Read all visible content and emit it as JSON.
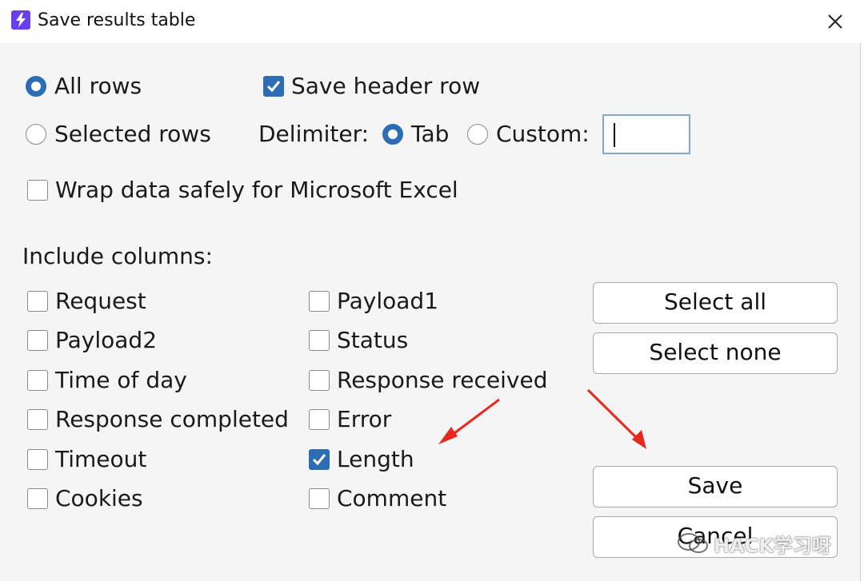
{
  "window": {
    "title": "Save results table"
  },
  "rows_option": {
    "all_rows": "All rows",
    "selected_rows": "Selected rows",
    "selected": "all_rows"
  },
  "save_header_row": {
    "label": "Save header row",
    "checked": true
  },
  "delimiter": {
    "label": "Delimiter:",
    "tab": "Tab",
    "custom": "Custom:",
    "selected": "tab",
    "custom_value": ""
  },
  "wrap_excel": {
    "label": "Wrap data safely for Microsoft Excel",
    "checked": false
  },
  "include_columns": {
    "heading": "Include columns:",
    "left": [
      {
        "label": "Request",
        "checked": false
      },
      {
        "label": "Payload2",
        "checked": false
      },
      {
        "label": "Time of day",
        "checked": false
      },
      {
        "label": "Response completed",
        "checked": false
      },
      {
        "label": "Timeout",
        "checked": false
      },
      {
        "label": "Cookies",
        "checked": false
      }
    ],
    "right": [
      {
        "label": "Payload1",
        "checked": false
      },
      {
        "label": "Status",
        "checked": false
      },
      {
        "label": "Response received",
        "checked": false
      },
      {
        "label": "Error",
        "checked": false
      },
      {
        "label": "Length",
        "checked": true
      },
      {
        "label": "Comment",
        "checked": false
      }
    ]
  },
  "buttons": {
    "select_all": "Select all",
    "select_none": "Select none",
    "save": "Save",
    "cancel": "Cancel"
  },
  "watermark": {
    "text": "HACK学习呀"
  },
  "colors": {
    "accent": "#2d6db5",
    "annotation_arrow": "#e8281e",
    "app_icon": "#6a3df0"
  }
}
